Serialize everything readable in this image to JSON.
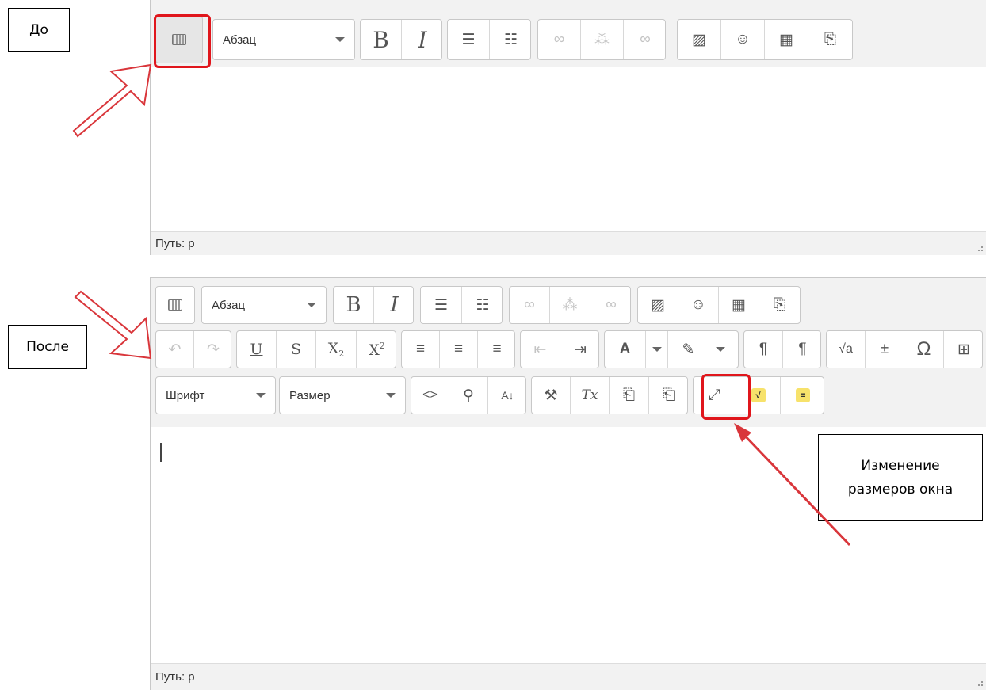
{
  "callouts": {
    "before": "До",
    "after": "После",
    "resize_note_line1": "Изменение",
    "resize_note_line2": "размеров окна"
  },
  "editor_before": {
    "format_select": "Абзац",
    "path_label": "Путь: p"
  },
  "editor_after": {
    "format_select": "Абзац",
    "font_select": "Шрифт",
    "size_select": "Размер",
    "path_label": "Путь: p"
  },
  "glyphs": {
    "bold": "B",
    "italic": "I",
    "underline": "U",
    "strike": "S",
    "sub_base": "X",
    "sub_idx": "2",
    "sup_base": "X",
    "sup_idx": "2",
    "omega": "Ω",
    "sqrt": "√a",
    "html": "<>",
    "clear_tx": "Tx",
    "yellow_sqrt": "√",
    "yellow_eq": "="
  },
  "colors": {
    "highlight_red": "#e0161c",
    "toolbar_bg": "#f2f2f2",
    "arrow_red": "#d9363b"
  }
}
